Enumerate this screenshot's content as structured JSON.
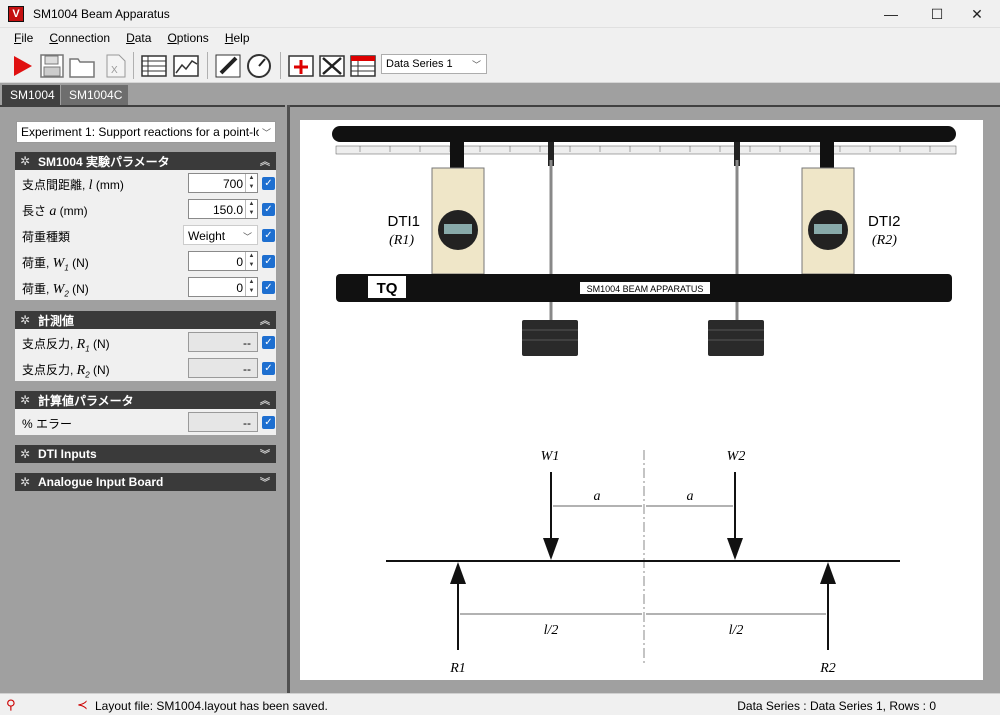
{
  "window": {
    "title": "SM1004 Beam Apparatus",
    "app_icon": "V",
    "minimize": "—",
    "maximize": "☐",
    "close": "✕"
  },
  "menu": [
    {
      "label": "File",
      "mnemonic": "F"
    },
    {
      "label": "Connection",
      "mnemonic": "C"
    },
    {
      "label": "Data",
      "mnemonic": "D"
    },
    {
      "label": "Options",
      "mnemonic": "O"
    },
    {
      "label": "Help",
      "mnemonic": "H"
    }
  ],
  "toolbar": {
    "icons": [
      "play-icon",
      "save-icon",
      "open-folder-icon",
      "excel-export-icon",
      "table-icon",
      "graph-icon",
      "pencil-icon",
      "gauge-icon",
      "add-series-icon",
      "delete-series-icon",
      "series-table-icon"
    ],
    "data_series_select": "Data Series 1"
  },
  "tabs": [
    {
      "label": "SM1004",
      "active": true
    },
    {
      "label": "SM1004C",
      "active": false
    }
  ],
  "experiment_select": "Experiment 1: Support reactions for a point-lo",
  "sections": {
    "params": {
      "title": "SM1004  実験パラメータ",
      "rows": [
        {
          "label": "支点間距離, ",
          "sym": "l",
          "sub": "",
          "unit": " (mm)",
          "value": "700"
        },
        {
          "label": "長さ ",
          "sym": "a",
          "sub": "",
          "unit": "  (mm)",
          "value": "150.0"
        },
        {
          "label": "荷重種類",
          "sym": "",
          "sub": "",
          "unit": "",
          "value": "Weight"
        },
        {
          "label": "荷重, ",
          "sym": "W",
          "sub": "1",
          "unit": " (N)",
          "value": "0"
        },
        {
          "label": "荷重, ",
          "sym": "W",
          "sub": "2",
          "unit": " (N)",
          "value": "0"
        }
      ]
    },
    "measured": {
      "title": "計測値",
      "rows": [
        {
          "label": "支点反力, ",
          "sym": "R",
          "sub": "1",
          "unit": " (N)",
          "value": "--"
        },
        {
          "label": "支点反力, ",
          "sym": "R",
          "sub": "2",
          "unit": " (N)",
          "value": "--"
        }
      ]
    },
    "calculated": {
      "title": "計算値パラメータ",
      "rows": [
        {
          "label": "% エラー",
          "value": "--"
        }
      ]
    },
    "dti": {
      "title": "DTI Inputs"
    },
    "analogue": {
      "title": "Analogue Input Board"
    }
  },
  "diagram": {
    "apparatus_label": "SM1004 BEAM APPARATUS",
    "logo": "TQ",
    "dti1": "DTI1",
    "dti1_sym": "(R1)",
    "dti2": "DTI2",
    "dti2_sym": "(R2)",
    "w1": "W1",
    "w2": "W2",
    "a_left": "a",
    "a_right": "a",
    "l2_left": "l/2",
    "l2_right": "l/2",
    "r1": "R1",
    "r2": "R2"
  },
  "status": {
    "layout_message": "Layout file: SM1004.layout has been saved.",
    "series_info": "Data Series : Data Series 1,  Rows : 0"
  }
}
